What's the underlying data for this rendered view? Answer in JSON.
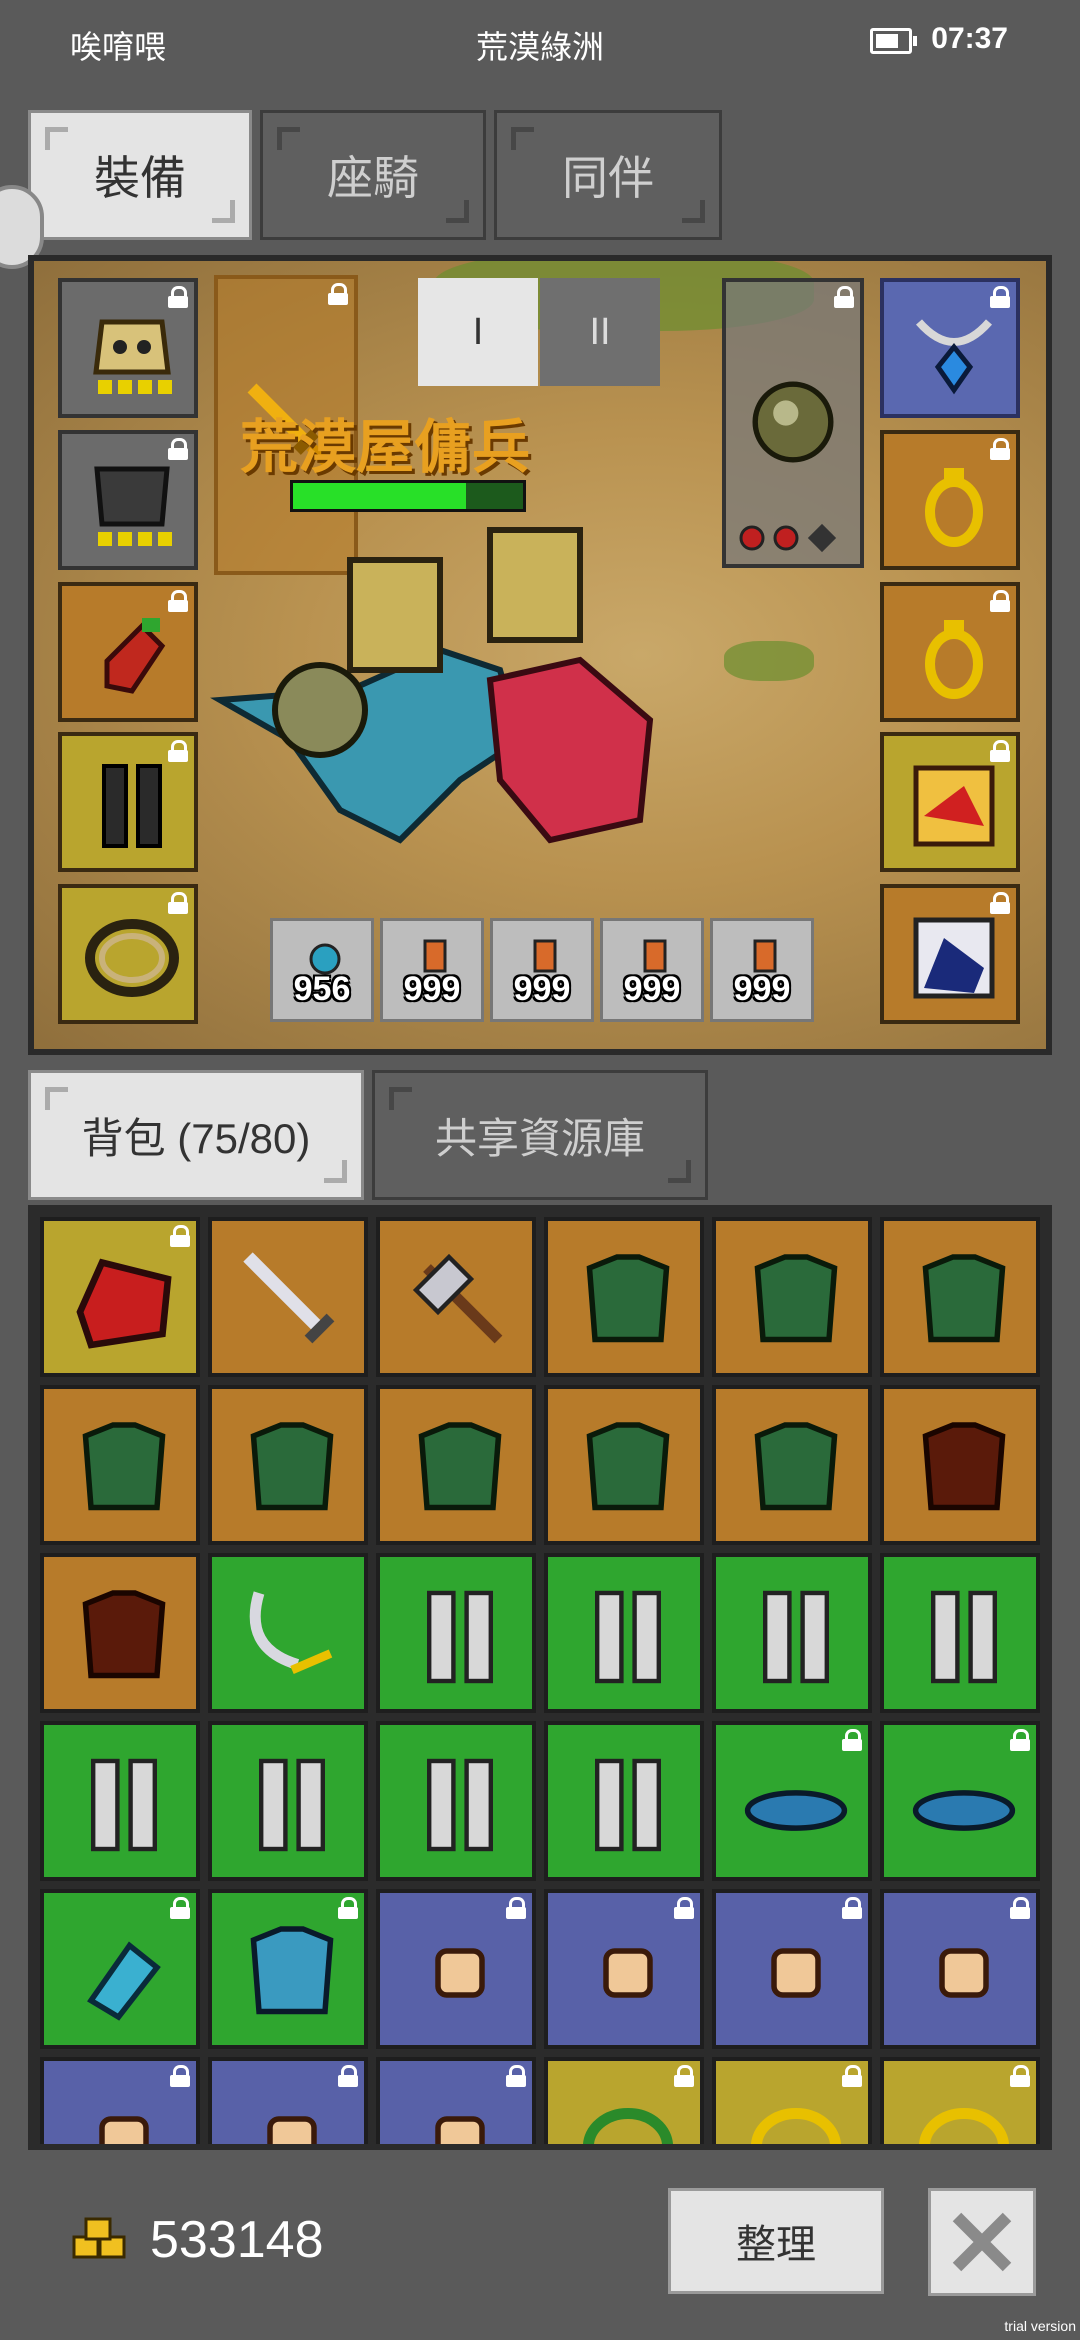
{
  "status": {
    "left": "唉唷喂",
    "location": "荒漠綠洲",
    "time": "07:37",
    "battery": 0.6
  },
  "top_tabs": [
    {
      "label": "裝備"
    },
    {
      "label": "座騎"
    },
    {
      "label": "同伴"
    }
  ],
  "character": {
    "name": "荒漠屋傭兵",
    "hp": 0.75
  },
  "page_buttons": [
    "I",
    "II"
  ],
  "potions": [
    "956",
    "999",
    "999",
    "999",
    "999"
  ],
  "bag_tabs": [
    {
      "label": "背包 (75/80)"
    },
    {
      "label": "共享資源庫"
    }
  ],
  "gold": "533148",
  "sort_label": "整理",
  "trial": "trial version",
  "colors": {
    "orange": "#b77b2a",
    "green": "#2fa62f",
    "blue": "#5861a8",
    "yellow": "#b9a52e"
  }
}
